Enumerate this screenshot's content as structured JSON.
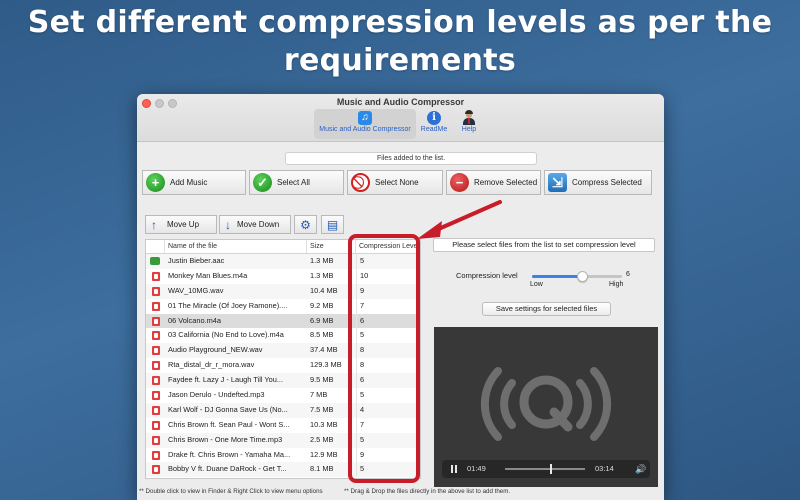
{
  "headline": {
    "line1": "Set different compression levels as per the",
    "line2": "requirements"
  },
  "window": {
    "title": "Music and Audio Compressor",
    "toolbar": [
      {
        "label": "Music and Audio Compressor",
        "icon": "music-note-icon",
        "active": true
      },
      {
        "label": "ReadMe",
        "icon": "info-icon",
        "active": false
      },
      {
        "label": "Help",
        "icon": "person-help-icon",
        "active": false
      }
    ]
  },
  "files_added_label": "Files added to the list.",
  "buttons": {
    "add_music": "Add Music",
    "select_all": "Select All",
    "select_none": "Select None",
    "remove_selected": "Remove Selected",
    "compress_selected": "Compress Selected",
    "move_up": "Move Up",
    "move_down": "Move Down",
    "settings_icon": "gear-icon",
    "list_icon": "list-icon"
  },
  "table": {
    "headers": {
      "name": "Name of the file",
      "size": "Size",
      "level": "Compression Level"
    },
    "rows": [
      {
        "icon": "aac-file-icon",
        "name": "Justin Bieber.aac",
        "size": "1.3 MB",
        "level": "5"
      },
      {
        "icon": "audio-file-icon",
        "name": "Monkey Man Blues.m4a",
        "size": "1.3 MB",
        "level": "10"
      },
      {
        "icon": "audio-file-icon",
        "name": "WAV_10MG.wav",
        "size": "10.4 MB",
        "level": "9"
      },
      {
        "icon": "audio-file-icon",
        "name": "01 The Miracle (Of Joey Ramone)....",
        "size": "9.2 MB",
        "level": "7"
      },
      {
        "icon": "audio-file-icon",
        "name": "06 Volcano.m4a",
        "size": "6.9 MB",
        "level": "6",
        "selected": true
      },
      {
        "icon": "audio-file-icon",
        "name": "03 California (No End to Love).m4a",
        "size": "8.5 MB",
        "level": "5"
      },
      {
        "icon": "audio-file-icon",
        "name": "Audio Playground_NEW.wav",
        "size": "37.4 MB",
        "level": "8"
      },
      {
        "icon": "audio-file-icon",
        "name": "Rta_distal_dr_r_mora.wav",
        "size": "129.3 MB",
        "level": "8"
      },
      {
        "icon": "audio-file-icon",
        "name": "Faydee ft. Lazy J - Laugh Till You...",
        "size": "9.5 MB",
        "level": "6"
      },
      {
        "icon": "audio-file-icon",
        "name": "Jason Derulo - Undefted.mp3",
        "size": "7 MB",
        "level": "5"
      },
      {
        "icon": "audio-file-icon",
        "name": "Karl Wolf - DJ Gonna Save Us (No...",
        "size": "7.5 MB",
        "level": "4"
      },
      {
        "icon": "audio-file-icon",
        "name": "Chris Brown ft. Sean Paul - Wont S...",
        "size": "10.3 MB",
        "level": "7"
      },
      {
        "icon": "audio-file-icon",
        "name": "Chris Brown - One More Time.mp3",
        "size": "2.5 MB",
        "level": "5"
      },
      {
        "icon": "audio-file-icon",
        "name": "Drake ft. Chris Brown - Yamaha Ma...",
        "size": "12.9 MB",
        "level": "9"
      },
      {
        "icon": "audio-file-icon",
        "name": "Bobby V ft. Duane DaRock - Get T...",
        "size": "8.1 MB",
        "level": "5"
      }
    ]
  },
  "settings_panel": {
    "hint": "Please select files from the list to set compression level",
    "compression_label": "Compression level",
    "compression_value": 6,
    "compression_value_text": "6",
    "min": 1,
    "max": 10,
    "low_label": "Low",
    "high_label": "High",
    "save_button": "Save settings for selected files"
  },
  "player": {
    "logo_icon": "audio-q-logo-icon",
    "current_time": "01:49",
    "total_time": "03:14",
    "progress": 0.56,
    "pause_icon": "pause-icon",
    "volume_icon": "speaker-icon"
  },
  "footer": {
    "left": "** Double click to view in Finder & Right Click to view menu options",
    "right": "** Drag & Drop the files directly in the above list to add them."
  },
  "colors": {
    "accent": "#3b82e8",
    "highlight_red": "#c91c2a",
    "background": "#3d6e9e"
  }
}
